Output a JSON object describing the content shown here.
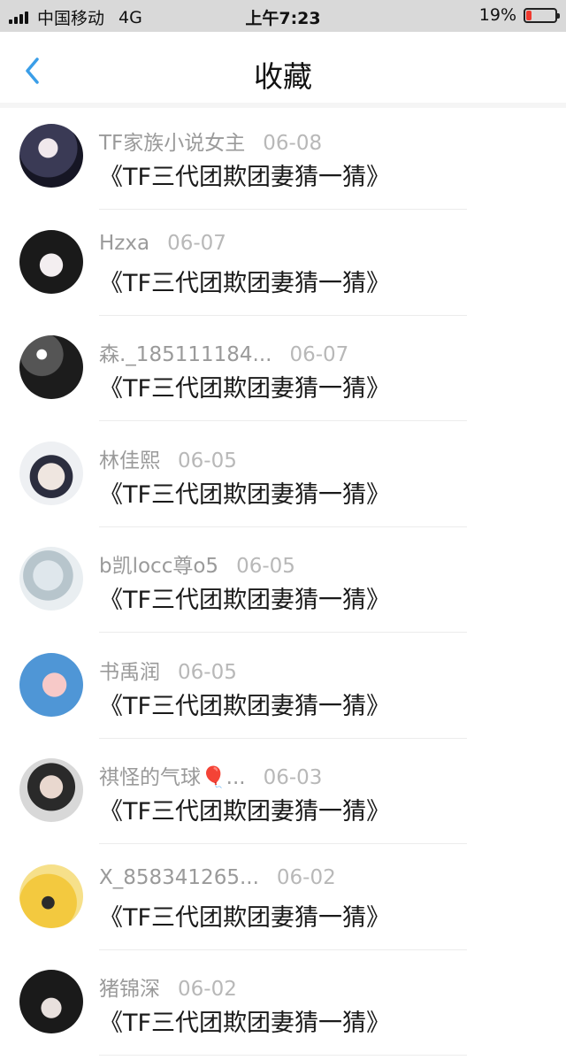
{
  "status_bar": {
    "carrier": "中国移动",
    "network": "4G",
    "time": "上午7:23",
    "battery": "19%",
    "battery_level": 0.19,
    "battery_color": "#f03a2f"
  },
  "header": {
    "title": "收藏",
    "back_icon": "chevron-left-icon",
    "accent": "#3a9ee8"
  },
  "items": [
    {
      "author": "TF家族小说女主",
      "date": "06-08",
      "title": "《TF三代团欺团妻猜一猜》"
    },
    {
      "author": "Hzxa",
      "date": "06-07",
      "title": "《TF三代团欺团妻猜一猜》"
    },
    {
      "author": "森._185111184...",
      "date": "06-07",
      "title": "《TF三代团欺团妻猜一猜》"
    },
    {
      "author": "林佳熙",
      "date": "06-05",
      "title": "《TF三代团欺团妻猜一猜》"
    },
    {
      "author": "b凯locc尊o5",
      "date": "06-05",
      "title": "《TF三代团欺团妻猜一猜》"
    },
    {
      "author": "书禹润",
      "date": "06-05",
      "title": "《TF三代团欺团妻猜一猜》"
    },
    {
      "author": "祺怪的气球🎈...",
      "date": "06-03",
      "title": "《TF三代团欺团妻猜一猜》"
    },
    {
      "author": "X_858341265...",
      "date": "06-02",
      "title": "《TF三代团欺团妻猜一猜》"
    },
    {
      "author": "猪锦深",
      "date": "06-02",
      "title": "《TF三代团欺团妻猜一猜》"
    }
  ]
}
